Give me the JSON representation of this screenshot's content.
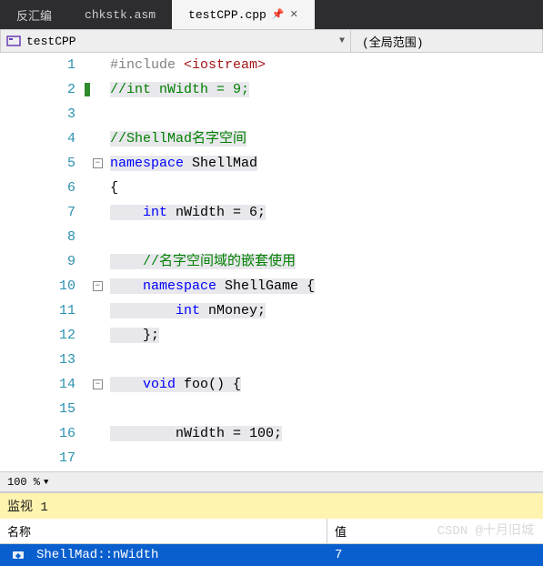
{
  "tabs": [
    {
      "label": "反汇编"
    },
    {
      "label": "chkstk.asm"
    },
    {
      "label": "testCPP.cpp",
      "active": true
    }
  ],
  "toolbar": {
    "scope_left": "testCPP",
    "scope_right": "(全局范围)"
  },
  "code": {
    "lines": [
      {
        "n": 1,
        "segs": [
          [
            "c-prep",
            "#include "
          ],
          [
            "c-str",
            "<iostream>"
          ]
        ]
      },
      {
        "n": 2,
        "segs": [
          [
            "c-comment",
            "//int nWidth = 9;"
          ]
        ],
        "mark": true,
        "hl": true
      },
      {
        "n": 3,
        "segs": []
      },
      {
        "n": 4,
        "segs": [
          [
            "c-comment",
            "//ShellMad名字空间"
          ]
        ],
        "hl": true
      },
      {
        "n": 5,
        "segs": [
          [
            "c-kw",
            "namespace"
          ],
          [
            "c-ident",
            " ShellMad"
          ]
        ],
        "hl": true,
        "fold": true
      },
      {
        "n": 6,
        "segs": [
          [
            "c-ident",
            "{"
          ]
        ]
      },
      {
        "n": 7,
        "segs": [
          [
            "c-type",
            "    int"
          ],
          [
            "c-ident",
            " nWidth = 6;"
          ]
        ],
        "hl": true
      },
      {
        "n": 8,
        "segs": []
      },
      {
        "n": 9,
        "segs": [
          [
            "c-comment",
            "    //名字空间域的嵌套使用"
          ]
        ],
        "hl": true
      },
      {
        "n": 10,
        "segs": [
          [
            "c-kw",
            "    namespace"
          ],
          [
            "c-ident",
            " ShellGame {"
          ]
        ],
        "hl": true,
        "fold": true
      },
      {
        "n": 11,
        "segs": [
          [
            "c-type",
            "        int"
          ],
          [
            "c-ident",
            " nMoney;"
          ]
        ],
        "hl": true
      },
      {
        "n": 12,
        "segs": [
          [
            "c-ident",
            "    };"
          ]
        ],
        "hl": true
      },
      {
        "n": 13,
        "segs": []
      },
      {
        "n": 14,
        "segs": [
          [
            "c-kw",
            "    void"
          ],
          [
            "c-ident",
            " foo() {"
          ]
        ],
        "hl": true,
        "fold": true
      },
      {
        "n": 15,
        "segs": []
      },
      {
        "n": 16,
        "segs": [
          [
            "c-ident",
            "        nWidth = 100;"
          ]
        ],
        "hl": true
      },
      {
        "n": 17,
        "segs": []
      }
    ]
  },
  "zoom": {
    "value": "100 %"
  },
  "watch": {
    "title": "监视 1",
    "col_name": "名称",
    "col_value": "值",
    "rows": [
      {
        "name": "ShellMad::nWidth",
        "value": "7"
      }
    ]
  },
  "watermark": "CSDN @十月旧城"
}
